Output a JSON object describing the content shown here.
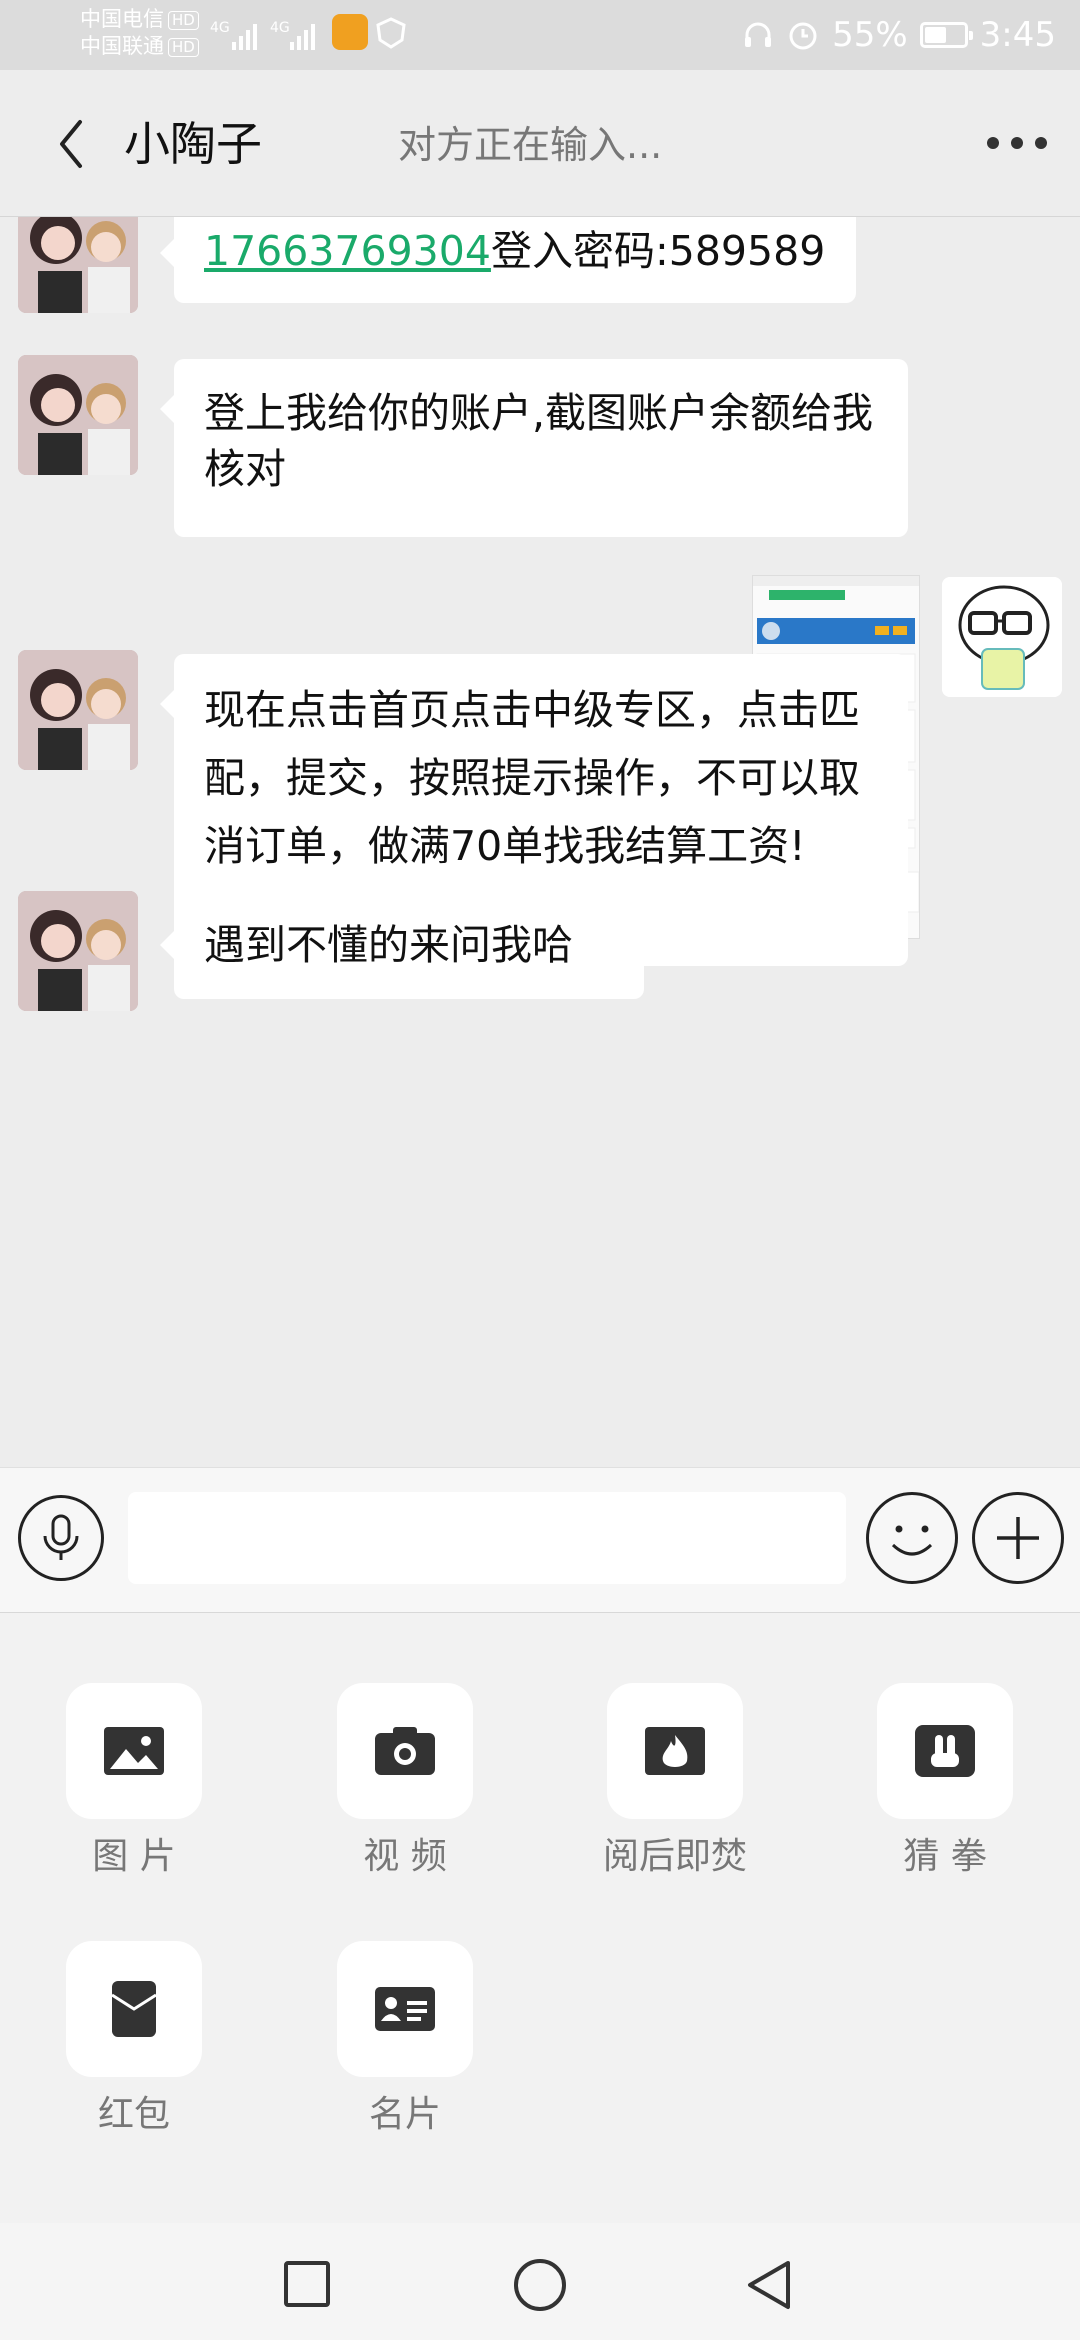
{
  "status_bar": {
    "carrier1": "中国电信",
    "carrier2": "中国联通",
    "hd": "HD",
    "net": "4G",
    "battery_pct": "55%",
    "battery_level": 0.55,
    "time": "3:45"
  },
  "header": {
    "contact_name": "小陶子",
    "typing_status": "对方正在输入..."
  },
  "messages": [
    {
      "from": "contact",
      "phone": "17663769304",
      "text": "登入密码:589589"
    },
    {
      "from": "contact",
      "text": "登上我给你的账户,截图账户余额给我核对"
    },
    {
      "from": "me",
      "type": "image"
    },
    {
      "from": "contact",
      "text": "现在点击首页点击中级专区，点击匹配，提交，按照提示操作，不可以取消订单，做满70单找我结算工资!"
    },
    {
      "from": "contact",
      "text": "遇到不懂的来问我哈"
    }
  ],
  "panel": {
    "items": [
      {
        "label": "图 片",
        "icon": "image-icon"
      },
      {
        "label": "视 频",
        "icon": "camera-icon"
      },
      {
        "label": "阅后即焚",
        "icon": "burn-icon"
      },
      {
        "label": "猜 拳",
        "icon": "rock-paper-scissors-icon"
      },
      {
        "label": "红包",
        "icon": "red-packet-icon"
      },
      {
        "label": "名片",
        "icon": "contact-card-icon"
      }
    ]
  },
  "colors": {
    "link": "#1aaa6a",
    "background": "#ededed"
  }
}
